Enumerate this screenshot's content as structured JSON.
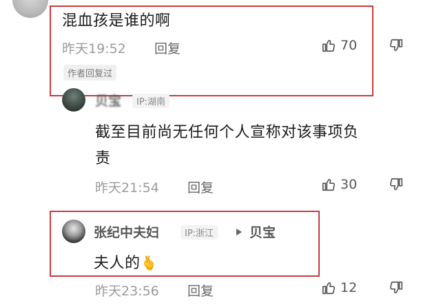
{
  "comment1": {
    "text": "混血孩是谁的啊",
    "time": "昨天19:52",
    "reply_label": "回复",
    "likes": "70",
    "author_badge": "作者回复过"
  },
  "reply1": {
    "name": "贝宝",
    "ip": "IP:湖南",
    "text_line1": "截至目前尚无任何个人宣称对该事项负",
    "text_line2": "责",
    "time": "昨天21:54",
    "reply_label": "回复",
    "likes": "30"
  },
  "reply2": {
    "name": "张纪中夫妇",
    "ip": "IP:浙江",
    "reply_to": "贝宝",
    "text": "夫人的",
    "emoji": "🫰",
    "time": "昨天23:56",
    "reply_label": "回复",
    "likes": "12"
  },
  "icons": {
    "like": "thumbs-up-icon",
    "dislike": "thumbs-down-icon",
    "arrow": "triangle-right-icon"
  },
  "colors": {
    "highlight_box": "#c8393b"
  }
}
